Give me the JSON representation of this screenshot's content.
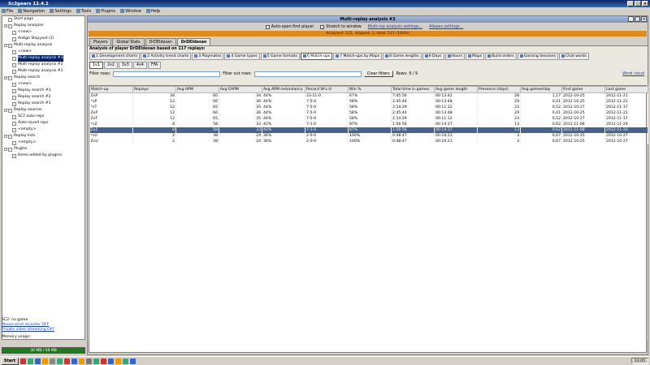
{
  "app": {
    "title": "Sc2gears 12.4.1"
  },
  "menu": {
    "items": [
      "File",
      "Navigation",
      "Settings",
      "Tools",
      "Plugins",
      "Window",
      "Help"
    ]
  },
  "tree": {
    "items": [
      {
        "label": "Start page",
        "level": 0,
        "selected": false
      },
      {
        "label": "Replay analyzer",
        "level": 0,
        "selected": false
      },
      {
        "label": "<new>",
        "level": 1,
        "selected": false
      },
      {
        "label": "Antiga Shipyard (2)",
        "level": 1,
        "selected": false
      },
      {
        "label": "Multi-replay analysis",
        "level": 0,
        "selected": false
      },
      {
        "label": "<new>",
        "level": 1,
        "selected": false
      },
      {
        "label": "Multi-replay analysis #3",
        "level": 1,
        "selected": true
      },
      {
        "label": "Multi-replay analysis #2",
        "level": 1,
        "selected": false
      },
      {
        "label": "Multi-replay analysis #1",
        "level": 1,
        "selected": false
      },
      {
        "label": "Replay search",
        "level": 0,
        "selected": false
      },
      {
        "label": "<new>",
        "level": 1,
        "selected": false
      },
      {
        "label": "Replay search #3",
        "level": 1,
        "selected": false
      },
      {
        "label": "Replay search #2",
        "level": 1,
        "selected": false
      },
      {
        "label": "Replay search #1",
        "level": 1,
        "selected": false
      },
      {
        "label": "Replay sources",
        "level": 0,
        "selected": false
      },
      {
        "label": "SC2 auto reps",
        "level": 1,
        "selected": false
      },
      {
        "label": "Auto-saved reps",
        "level": 1,
        "selected": false
      },
      {
        "label": "<empty>",
        "level": 1,
        "selected": false
      },
      {
        "label": "Replay lists",
        "level": 0,
        "selected": false
      },
      {
        "label": "<empty>",
        "level": 1,
        "selected": false
      },
      {
        "label": "Plugins",
        "level": 0,
        "selected": false
      },
      {
        "label": "Items added by plugins:",
        "level": 1,
        "selected": false
      }
    ]
  },
  "sidebar_bottom": {
    "status": "SC2: no game",
    "mouse_link": "Mouse print recorder OFF",
    "stream_link": "Private video streaming OFF",
    "memory_label": "Memory usage:",
    "memory_value": "30 MB / 58 MB"
  },
  "main": {
    "title": "Multi-replay analysis #3",
    "opt_auto_open": "Auto-open first player",
    "opt_stretch": "Stretch to window",
    "link_settings": "Multi-rep analysis settings...",
    "link_aliases": "Aliases settings...",
    "progress_text": "Analyzed: 121, skipped: 1, total: 121 (100%)",
    "top_tabs": [
      "Players",
      "Global Stats",
      "DrDEIdesan",
      "DrDEIdesan"
    ],
    "info": "Analysis of player DrDEIdesan based on 117 replays:",
    "sub_tabs": [
      "1 Development charts",
      "2 Activity trend charts",
      "3 Playmates",
      "4 Game types",
      "5 Game formats",
      "6 Match-ups",
      "7 Match-ups by Maps",
      "8 Game lengths",
      "9 Days",
      "Hours",
      "Maps",
      "Build orders",
      "Gaming Sessions",
      "Chat words"
    ],
    "format_tabs": [
      "1v1",
      "2v2",
      "3v3",
      "4v4",
      "FFA"
    ],
    "filter_rows_label": "Filter rows:",
    "filter_out_label": "Filter out rows:",
    "clear_filters": "Clear filters",
    "rows_text": "Rows: 9 / 9",
    "word_cloud": "Word cloud"
  },
  "table": {
    "headers": [
      "Match-up",
      "Replays",
      "Avg APM",
      "Avg EAPM",
      "Avg APM redundancy",
      "Record W-L-U",
      "Win %",
      "Total time in games",
      "Avg game length",
      "Presence (days)",
      "Avg games/day",
      "First game",
      "Last game"
    ],
    "rows": [
      [
        "ZvP",
        "34",
        "60",
        "34",
        "44%",
        "23-11-0",
        "67%",
        "7:45:56",
        "00:13:42",
        "28",
        "1,17",
        "2012-10-25",
        "2012-11-21"
      ],
      [
        "*vP",
        "12",
        "66",
        "36",
        "44%",
        "7-5-0",
        "58%",
        "2:45:44",
        "00:13:48",
        "29",
        "0,41",
        "2012-10-25",
        "2012-11-21"
      ],
      [
        "*vT",
        "12",
        "65",
        "35",
        "44%",
        "7-5-0",
        "58%",
        "2:14:29",
        "00:11:12",
        "23",
        "0,52",
        "2012-10-27",
        "2012-11-17"
      ],
      [
        "ZvP",
        "12",
        "66",
        "36",
        "44%",
        "7-5-0",
        "58%",
        "2:45:44",
        "00:13:48",
        "29",
        "0,41",
        "2012-10-25",
        "2012-11-21"
      ],
      [
        "ZvT",
        "12",
        "65",
        "35",
        "44%",
        "7-5-0",
        "58%",
        "2:14:29",
        "00:11:12",
        "23",
        "0,52",
        "2012-10-27",
        "2012-11-17"
      ],
      [
        "*vZ",
        "8",
        "58",
        "33",
        "42%",
        "7-1-0",
        "87%",
        "1:56:56",
        "00:14:37",
        "13",
        "0,62",
        "2012-11-08",
        "2012-11-29"
      ],
      [
        "ZvZ",
        "8",
        "58",
        "33",
        "42%",
        "7-1-0",
        "87%",
        "1:56:56",
        "00:14:37",
        "13",
        "0,62",
        "2012-11-08",
        "2012-11-20"
      ],
      [
        "*vU",
        "2",
        "38",
        "24",
        "36%",
        "2-0-0",
        "100%",
        "0:48:47",
        "00:24:23",
        "3",
        "0,67",
        "2012-10-25",
        "2012-10-27"
      ],
      [
        "ZvU",
        "2",
        "38",
        "24",
        "36%",
        "2-0-0",
        "100%",
        "0:48:47",
        "00:24:23",
        "3",
        "0,67",
        "2012-10-25",
        "2012-10-27"
      ]
    ],
    "selected_row": 6
  },
  "taskbar": {
    "start": "Start",
    "clock": "13:05"
  }
}
